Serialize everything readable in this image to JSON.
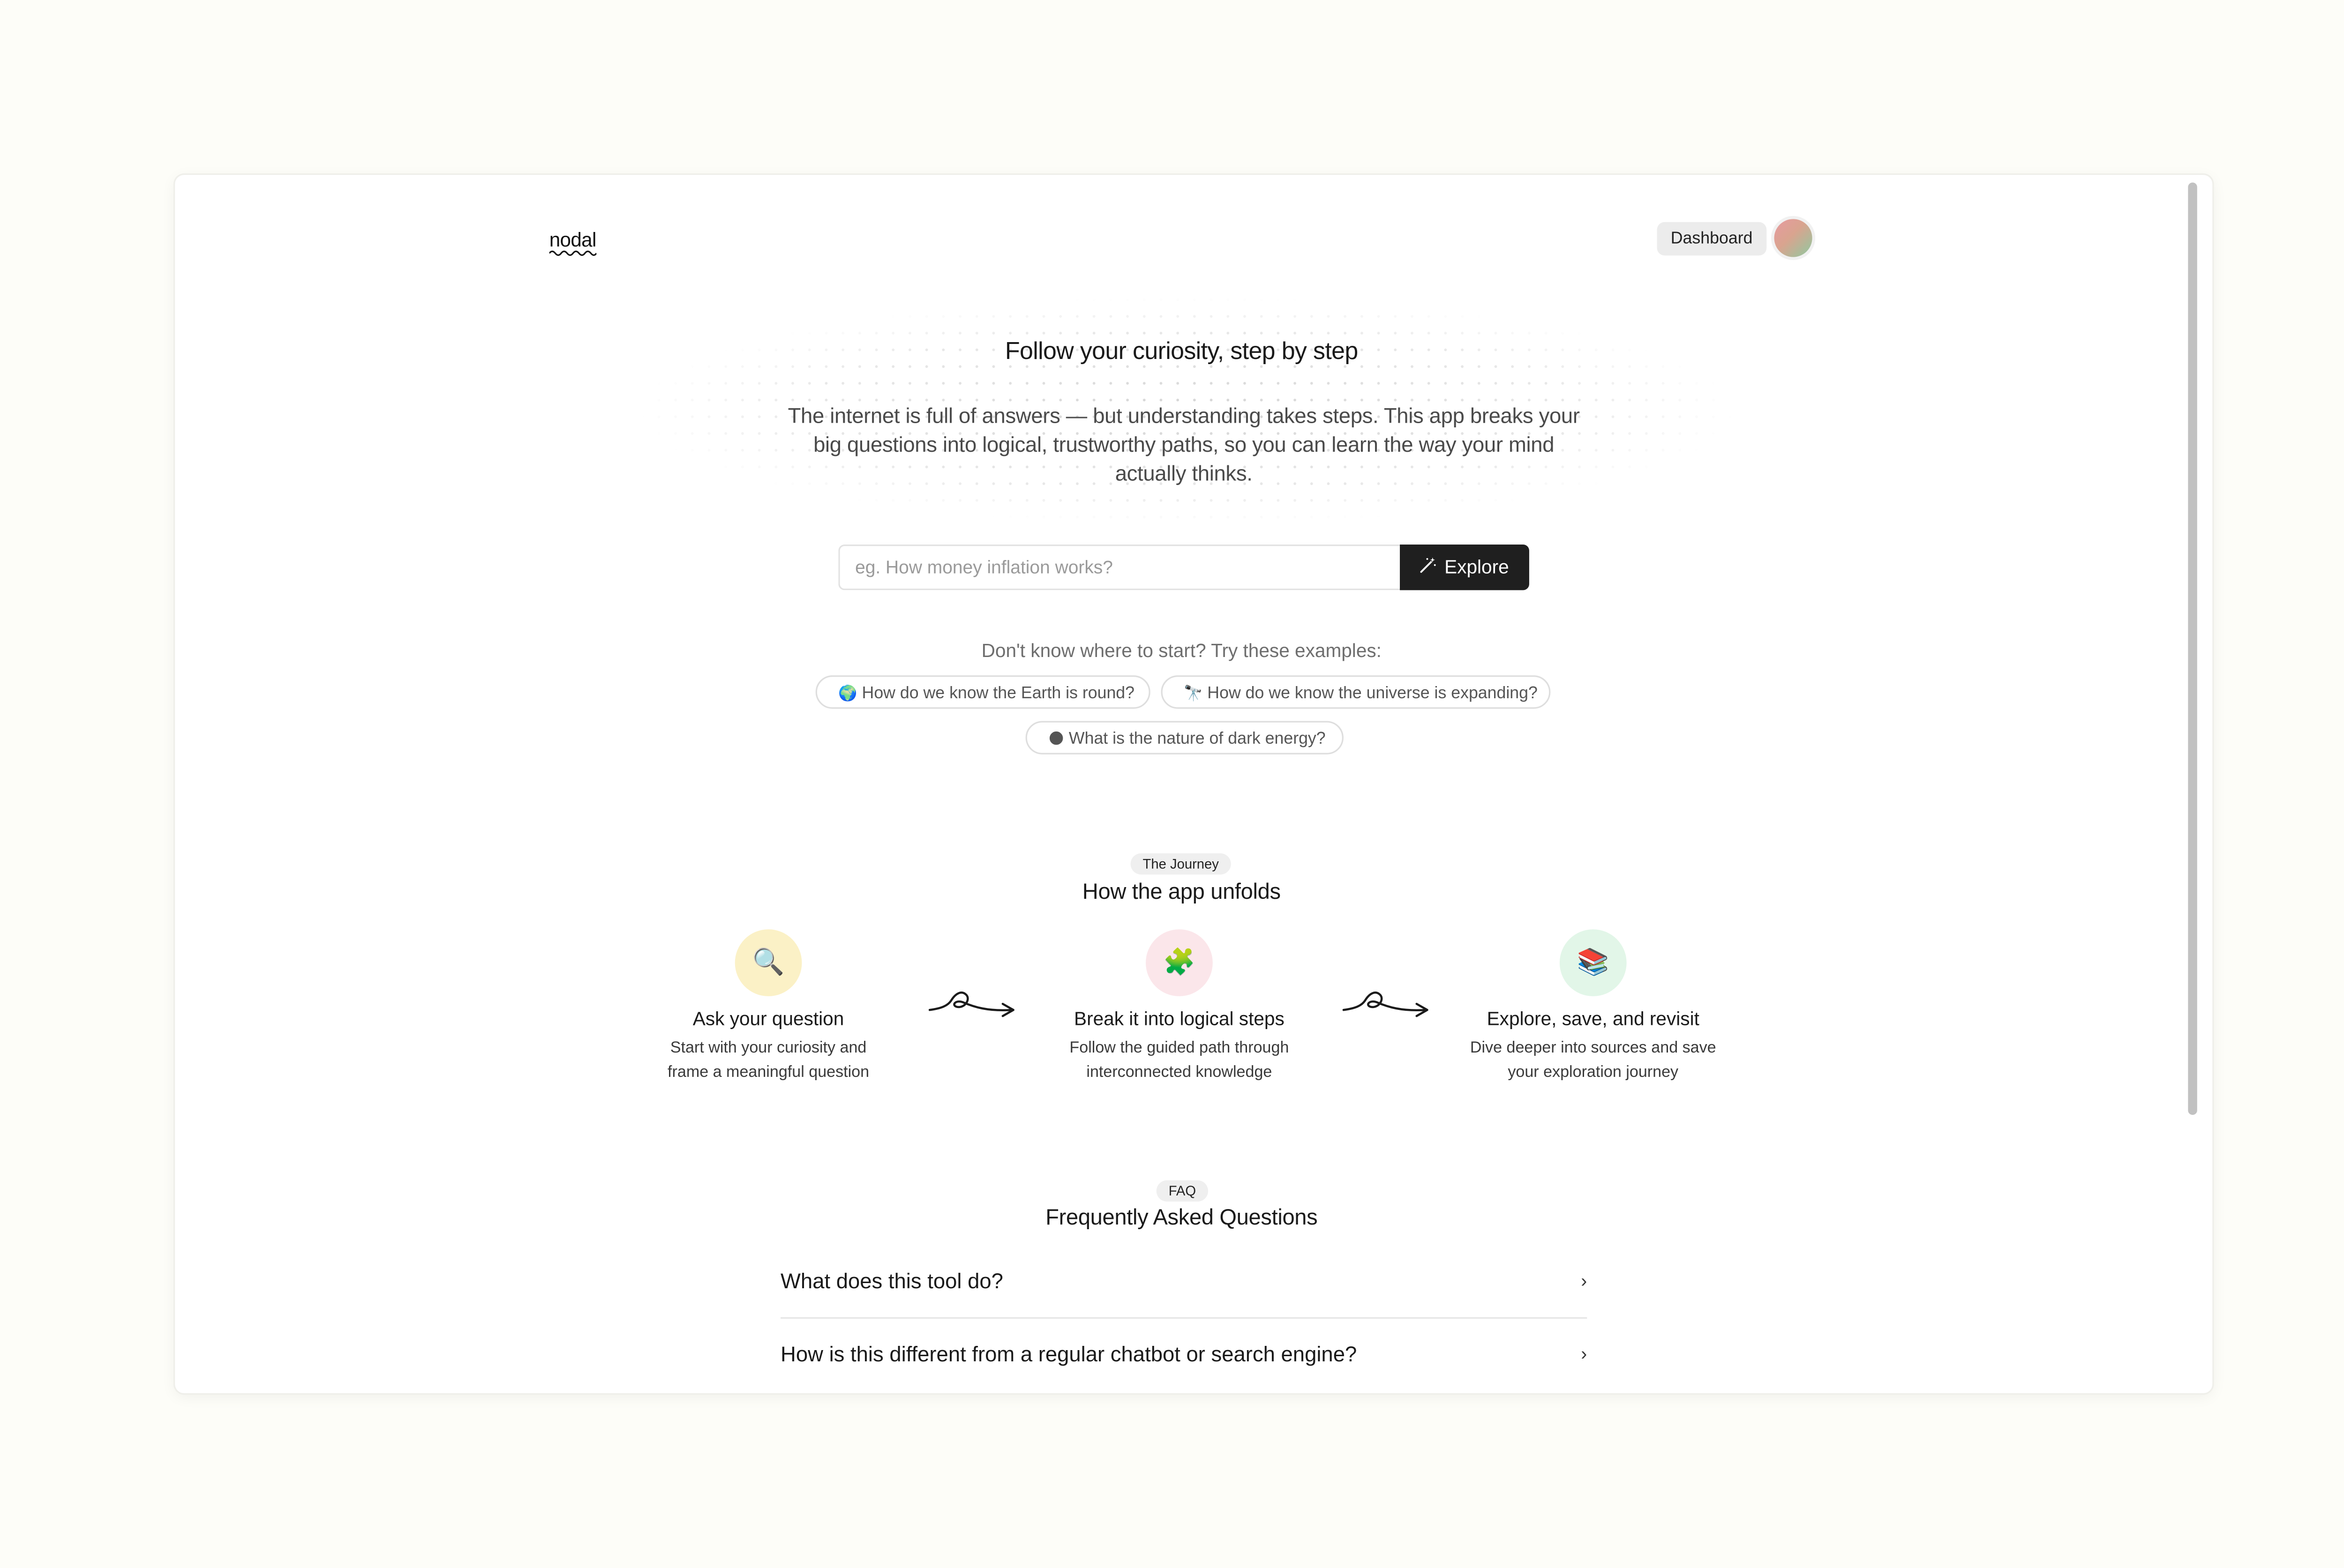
{
  "header": {
    "logo": "nodal",
    "dashboard_label": "Dashboard"
  },
  "hero": {
    "title": "Follow your curiosity, step by step",
    "subtitle": "The internet is full of answers — but understanding takes steps. This app breaks your big questions into logical, trustworthy paths, so you can learn the way your mind actually thinks."
  },
  "search": {
    "placeholder": "eg. How money inflation works?",
    "value": "",
    "button_label": "Explore",
    "button_icon": "magic-wand-icon"
  },
  "examples": {
    "label": "Don't know where to start? Try these examples:",
    "items": [
      {
        "icon": "🌍",
        "icon_name": "globe-icon",
        "text": "How do we know the Earth is round?"
      },
      {
        "icon": "🔭",
        "icon_name": "telescope-icon",
        "text": "How do we know the universe is expanding?"
      },
      {
        "icon": "🌑",
        "icon_name": "new-moon-icon",
        "text": "What is the nature of dark energy?"
      }
    ]
  },
  "journey": {
    "badge": "The Journey",
    "title": "How the app unfolds",
    "steps": [
      {
        "icon": "🔍",
        "icon_name": "magnifier-icon",
        "title": "Ask your question",
        "desc_line1": "Start with your curiosity and",
        "desc_line2": "frame a meaningful question",
        "bg": "#fbf1c6"
      },
      {
        "icon": "🧩",
        "icon_name": "puzzle-piece-icon",
        "title": "Break it into logical steps",
        "desc_line1": "Follow the guided path through",
        "desc_line2": "interconnected knowledge",
        "bg": "#fbe6ea"
      },
      {
        "icon": "📚",
        "icon_name": "books-icon",
        "title": "Explore, save, and revisit",
        "desc_line1": "Dive deeper into sources and save",
        "desc_line2": "your exploration journey",
        "bg": "#e2f6e8"
      }
    ]
  },
  "faq": {
    "badge": "FAQ",
    "title": "Frequently Asked Questions",
    "items": [
      {
        "question": "What does this tool do?"
      },
      {
        "question": "How is this different from a regular chatbot or search engine?"
      }
    ]
  },
  "colors": {
    "page_bg": "#fdfdf8",
    "accent_dark": "#1f1f1f"
  }
}
